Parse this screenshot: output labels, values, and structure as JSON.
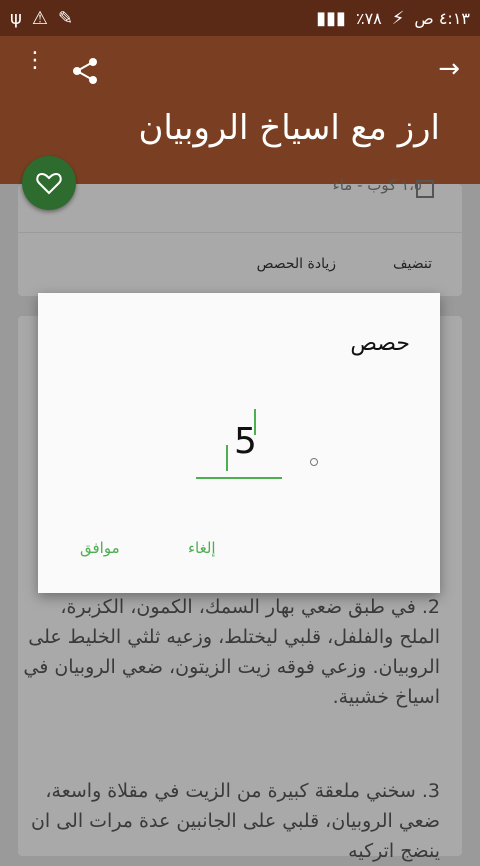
{
  "statusbar": {
    "time": "٤:١٣ ص",
    "battery": "٪٧٨",
    "left_icons": [
      "usb-icon",
      "warning-icon",
      "edit-icon"
    ],
    "right_icons": [
      "signal-icon",
      "battery-charging-icon"
    ]
  },
  "appbar": {
    "title": "ارز مع اسياخ الروبيان"
  },
  "card1": {
    "meta": "١،٥ كوب - ماء",
    "action_clean": "تنضيف",
    "action_increase": "زيادة الحصص"
  },
  "steps": [
    {
      "number": "2.",
      "text": "في طبق ضعي بهار السمك، الكمون، الكزبرة، الملح والفلفل، قلبي ليختلط، وزعيه ثلثي الخليط على الروبيان. وزعي فوقه زيت الزيتون، ضعي الروبيان في اسياخ خشبية."
    },
    {
      "number": "3.",
      "text": "سخني ملعقة كبيرة من الزيت في مقلاة واسعة، ضعي الروبيان، قلبي على الجانبين عدة مرات الى ان ينضج اتركيه"
    }
  ],
  "dialog": {
    "title": "حصص",
    "value": "5",
    "ok_label": "موافق",
    "cancel_label": "إلغاء"
  },
  "colors": {
    "statusbar": "#5b2a17",
    "appbar": "#7a3f22",
    "fab": "#2e6b2e",
    "accent": "#4caf50"
  }
}
